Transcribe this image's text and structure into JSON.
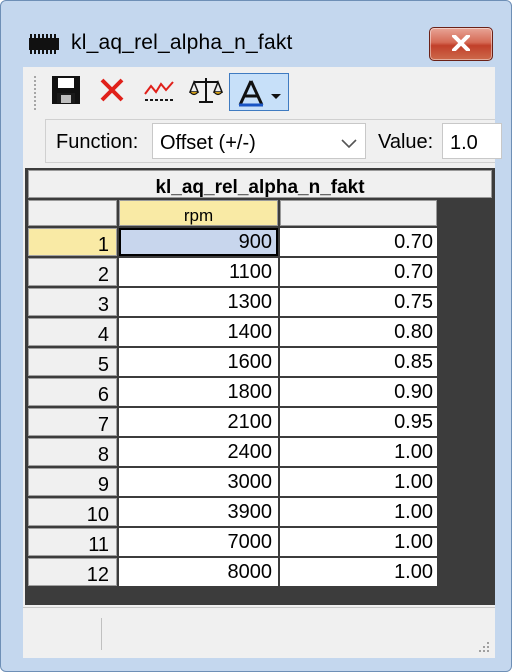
{
  "window": {
    "title": "kl_aq_rel_alpha_n_fakt"
  },
  "icons": {
    "app": "chip-icon",
    "close": "close-icon",
    "save": "floppy-disk-icon",
    "delete": "red-x-icon",
    "graph": "line-graph-icon",
    "balance": "scales-icon",
    "interpolation": "interpolation-tool-icon",
    "dropdown": "chevron-down-icon"
  },
  "toolbar": {
    "function_label": "Function:",
    "function_value": "Offset (+/-)",
    "value_label": "Value:",
    "value_input": "1.0"
  },
  "table": {
    "caption": "kl_aq_rel_alpha_n_fakt",
    "x_header": "rpm",
    "y_header": "",
    "selected_row": 1,
    "row_numbers": [
      "1",
      "2",
      "3",
      "4",
      "5",
      "6",
      "7",
      "8",
      "9",
      "10",
      "11",
      "12"
    ],
    "x_values": [
      "900",
      "1100",
      "1300",
      "1400",
      "1600",
      "1800",
      "2100",
      "2400",
      "3000",
      "3900",
      "7000",
      "8000"
    ],
    "y_values": [
      "0.70",
      "0.70",
      "0.75",
      "0.80",
      "0.85",
      "0.90",
      "0.95",
      "1.00",
      "1.00",
      "1.00",
      "1.00",
      "1.00"
    ]
  },
  "colors": {
    "selected_row_header": "#f9eaa5",
    "selected_cell": "#c8d6ed",
    "close_button": "#c8442d",
    "delete_icon": "#e0201a"
  }
}
